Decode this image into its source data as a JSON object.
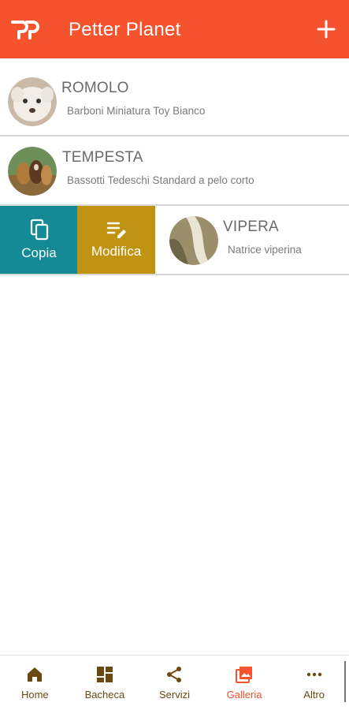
{
  "app": {
    "title": "Petter Planet",
    "brand_color": "#f5532d"
  },
  "pets": [
    {
      "name": "ROMOLO",
      "breed": "Barboni Miniatura Toy Bianco",
      "avatar": "white-poodle-photo"
    },
    {
      "name": "TEMPESTA",
      "breed": "Bassotti Tedeschi Standard a pelo corto",
      "avatar": "dachshund-photo"
    },
    {
      "name": "VIPERA",
      "breed": "Natrice viperina",
      "avatar": "snake-photo"
    }
  ],
  "swipe_actions": {
    "copy_label": "Copia",
    "copy_color": "#158a97",
    "edit_label": "Modifica",
    "edit_color": "#c09312"
  },
  "bottom_nav": [
    {
      "label": "Home",
      "icon": "home-icon"
    },
    {
      "label": "Bacheca",
      "icon": "dashboard-icon"
    },
    {
      "label": "Servizi",
      "icon": "share-icon"
    },
    {
      "label": "Galleria",
      "icon": "gallery-icon",
      "active": true
    },
    {
      "label": "Altro",
      "icon": "more-icon"
    }
  ]
}
